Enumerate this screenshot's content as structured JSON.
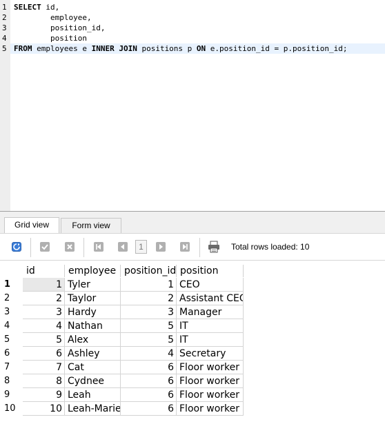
{
  "editor": {
    "lines": [
      {
        "num": "1",
        "parts": [
          {
            "t": "SELECT",
            "kw": true
          },
          {
            "t": " id,",
            "kw": false
          }
        ]
      },
      {
        "num": "2",
        "parts": [
          {
            "t": "        employee,",
            "kw": false
          }
        ]
      },
      {
        "num": "3",
        "parts": [
          {
            "t": "        position_id,",
            "kw": false
          }
        ]
      },
      {
        "num": "4",
        "parts": [
          {
            "t": "        position",
            "kw": false
          }
        ]
      },
      {
        "num": "5",
        "parts": [
          {
            "t": "FROM",
            "kw": true
          },
          {
            "t": " employees e ",
            "kw": false
          },
          {
            "t": "INNER JOIN",
            "kw": true
          },
          {
            "t": " positions p ",
            "kw": false
          },
          {
            "t": "ON",
            "kw": true
          },
          {
            "t": " e.position_id = p.position_id;",
            "kw": false
          }
        ]
      }
    ]
  },
  "tabs": {
    "grid_view": "Grid view",
    "form_view": "Form view"
  },
  "toolbar": {
    "page_number": "1",
    "rows_loaded": "Total rows loaded: 10"
  },
  "grid": {
    "columns": [
      "id",
      "employee",
      "position_id",
      "position"
    ],
    "rows": [
      {
        "n": "1",
        "id": "1",
        "employee": "Tyler",
        "position_id": "1",
        "position": "CEO"
      },
      {
        "n": "2",
        "id": "2",
        "employee": "Taylor",
        "position_id": "2",
        "position": "Assistant CEO"
      },
      {
        "n": "3",
        "id": "3",
        "employee": "Hardy",
        "position_id": "3",
        "position": "Manager"
      },
      {
        "n": "4",
        "id": "4",
        "employee": "Nathan",
        "position_id": "5",
        "position": "IT"
      },
      {
        "n": "5",
        "id": "5",
        "employee": "Alex",
        "position_id": "5",
        "position": "IT"
      },
      {
        "n": "6",
        "id": "6",
        "employee": "Ashley",
        "position_id": "4",
        "position": "Secretary"
      },
      {
        "n": "7",
        "id": "7",
        "employee": "Cat",
        "position_id": "6",
        "position": "Floor worker"
      },
      {
        "n": "8",
        "id": "8",
        "employee": "Cydnee",
        "position_id": "6",
        "position": "Floor worker"
      },
      {
        "n": "9",
        "id": "9",
        "employee": "Leah",
        "position_id": "6",
        "position": "Floor worker"
      },
      {
        "n": "10",
        "id": "10",
        "employee": "Leah-Marie",
        "position_id": "6",
        "position": "Floor worker"
      }
    ]
  },
  "colors": {
    "current_line": "#e8f2fe",
    "refresh_icon": "#3b7dd8",
    "disabled_icon": "#a8a8a8"
  }
}
